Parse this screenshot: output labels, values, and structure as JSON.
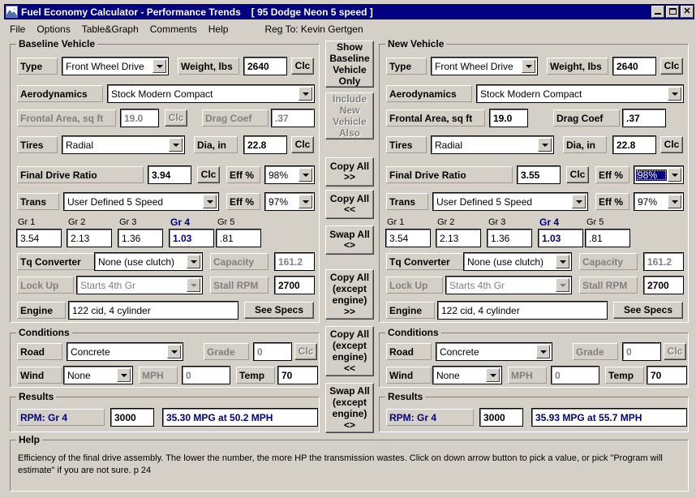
{
  "window": {
    "title": "Fuel Economy Calculator - Performance Trends",
    "subtitle": "[ 95 Dodge Neon 5 speed ]",
    "minimize_label": "",
    "maximize_label": "",
    "close_label": "✕"
  },
  "menubar": {
    "items": [
      {
        "label": "File"
      },
      {
        "label": "Options"
      },
      {
        "label": "Table&Graph"
      },
      {
        "label": "Comments"
      },
      {
        "label": "Help"
      }
    ],
    "reg_to": "Reg To: Kevin Gertgen"
  },
  "middle_buttons": [
    {
      "label": "Show\nBaseline\nVehicle\nOnly",
      "disabled": false
    },
    {
      "label": "Include\nNew\nVehicle\nAlso",
      "disabled": true
    },
    {
      "label": "Copy All\n>>",
      "disabled": false
    },
    {
      "label": "Copy All\n<<",
      "disabled": false
    },
    {
      "label": "Swap All\n<>",
      "disabled": false
    },
    {
      "label": "Copy All\n(except\nengine)\n>>",
      "disabled": false
    },
    {
      "label": "Copy All\n(except\nengine)\n<<",
      "disabled": false
    },
    {
      "label": "Swap All\n(except\nengine)\n<>",
      "disabled": false
    }
  ],
  "baseline": {
    "group_title": "Baseline Vehicle",
    "type_label": "Type",
    "type_value": "Front Wheel Drive",
    "weight_label": "Weight, lbs",
    "weight_value": "2640",
    "weight_clc": "Clc",
    "aero_label": "Aerodynamics",
    "aero_value": "Stock Modern Compact",
    "frontal_label": "Frontal Area, sq ft",
    "frontal_value": "19.0",
    "frontal_clc": "Clc",
    "drag_label": "Drag Coef",
    "drag_value": ".37",
    "tires_label": "Tires",
    "tires_value": "Radial",
    "dia_label": "Dia, in",
    "dia_value": "22.8",
    "dia_clc": "Clc",
    "fdr_label": "Final Drive Ratio",
    "fdr_value": "3.94",
    "fdr_clc": "Clc",
    "fdr_eff_label": "Eff %",
    "fdr_eff_value": "98%",
    "trans_label": "Trans",
    "trans_value": "User Defined 5 Speed",
    "trans_eff_label": "Eff %",
    "trans_eff_value": "97%",
    "gears": [
      {
        "label": "Gr 1",
        "value": "3.54",
        "active": false
      },
      {
        "label": "Gr 2",
        "value": "2.13",
        "active": false
      },
      {
        "label": "Gr 3",
        "value": "1.36",
        "active": false
      },
      {
        "label": "Gr 4",
        "value": "1.03",
        "active": true
      },
      {
        "label": "Gr 5",
        "value": ".81",
        "active": false
      }
    ],
    "tq_label": "Tq Converter",
    "tq_value": "None (use clutch)",
    "capacity_label": "Capacity",
    "capacity_value": "161.2",
    "lockup_label": "Lock Up",
    "lockup_value": "Starts 4th Gr",
    "stall_label": "Stall RPM",
    "stall_value": "2700",
    "engine_label": "Engine",
    "engine_value": "122 cid, 4 cylinder",
    "see_specs": "See Specs",
    "conditions": {
      "group_title": "Conditions",
      "road_label": "Road",
      "road_value": "Concrete",
      "grade_label": "Grade",
      "grade_value": "0",
      "grade_clc": "Clc",
      "wind_label": "Wind",
      "wind_value": "None",
      "mph_label": "MPH",
      "mph_value": "0",
      "temp_label": "Temp",
      "temp_value": "70"
    },
    "results": {
      "group_title": "Results",
      "rpm_label": "RPM: Gr 4",
      "rpm_value": "3000",
      "summary": "35.30 MPG at 50.2 MPH"
    }
  },
  "newvehicle": {
    "group_title": "New Vehicle",
    "type_label": "Type",
    "type_value": "Front Wheel Drive",
    "weight_label": "Weight, lbs",
    "weight_value": "2640",
    "weight_clc": "Clc",
    "aero_label": "Aerodynamics",
    "aero_value": "Stock Modern Compact",
    "frontal_label": "Frontal Area, sq ft",
    "frontal_value": "19.0",
    "drag_label": "Drag Coef",
    "drag_value": ".37",
    "tires_label": "Tires",
    "tires_value": "Radial",
    "dia_label": "Dia, in",
    "dia_value": "22.8",
    "dia_clc": "Clc",
    "fdr_label": "Final Drive Ratio",
    "fdr_value": "3.55",
    "fdr_clc": "Clc",
    "fdr_eff_label": "Eff %",
    "fdr_eff_value": "98%",
    "trans_label": "Trans",
    "trans_value": "User Defined 5 Speed",
    "trans_eff_label": "Eff %",
    "trans_eff_value": "97%",
    "gears": [
      {
        "label": "Gr 1",
        "value": "3.54",
        "active": false
      },
      {
        "label": "Gr 2",
        "value": "2.13",
        "active": false
      },
      {
        "label": "Gr 3",
        "value": "1.36",
        "active": false
      },
      {
        "label": "Gr 4",
        "value": "1.03",
        "active": true
      },
      {
        "label": "Gr 5",
        "value": ".81",
        "active": false
      }
    ],
    "tq_label": "Tq Converter",
    "tq_value": "None (use clutch)",
    "capacity_label": "Capacity",
    "capacity_value": "161.2",
    "lockup_label": "Lock Up",
    "lockup_value": "Starts 4th Gr",
    "stall_label": "Stall RPM",
    "stall_value": "2700",
    "engine_label": "Engine",
    "engine_value": "122 cid, 4 cylinder",
    "see_specs": "See Specs",
    "conditions": {
      "group_title": "Conditions",
      "road_label": "Road",
      "road_value": "Concrete",
      "grade_label": "Grade",
      "grade_value": "0",
      "grade_clc": "Clc",
      "wind_label": "Wind",
      "wind_value": "None",
      "mph_label": "MPH",
      "mph_value": "0",
      "temp_label": "Temp",
      "temp_value": "70"
    },
    "results": {
      "group_title": "Results",
      "rpm_label": "RPM: Gr 4",
      "rpm_value": "3000",
      "summary": "35.93 MPG at 55.7 MPH"
    }
  },
  "help": {
    "group_title": "Help",
    "text": "Efficiency of the final drive assembly.   The lower the number, the more HP the transmission wastes.   Click on down arrow button to pick a value, or pick \"Program will estimate\" if you are not sure.  p 24"
  },
  "colors": {
    "titlebar": "#000080",
    "face": "#d4d0c8",
    "accent_blue": "#000080",
    "disabled_text": "#808080"
  }
}
